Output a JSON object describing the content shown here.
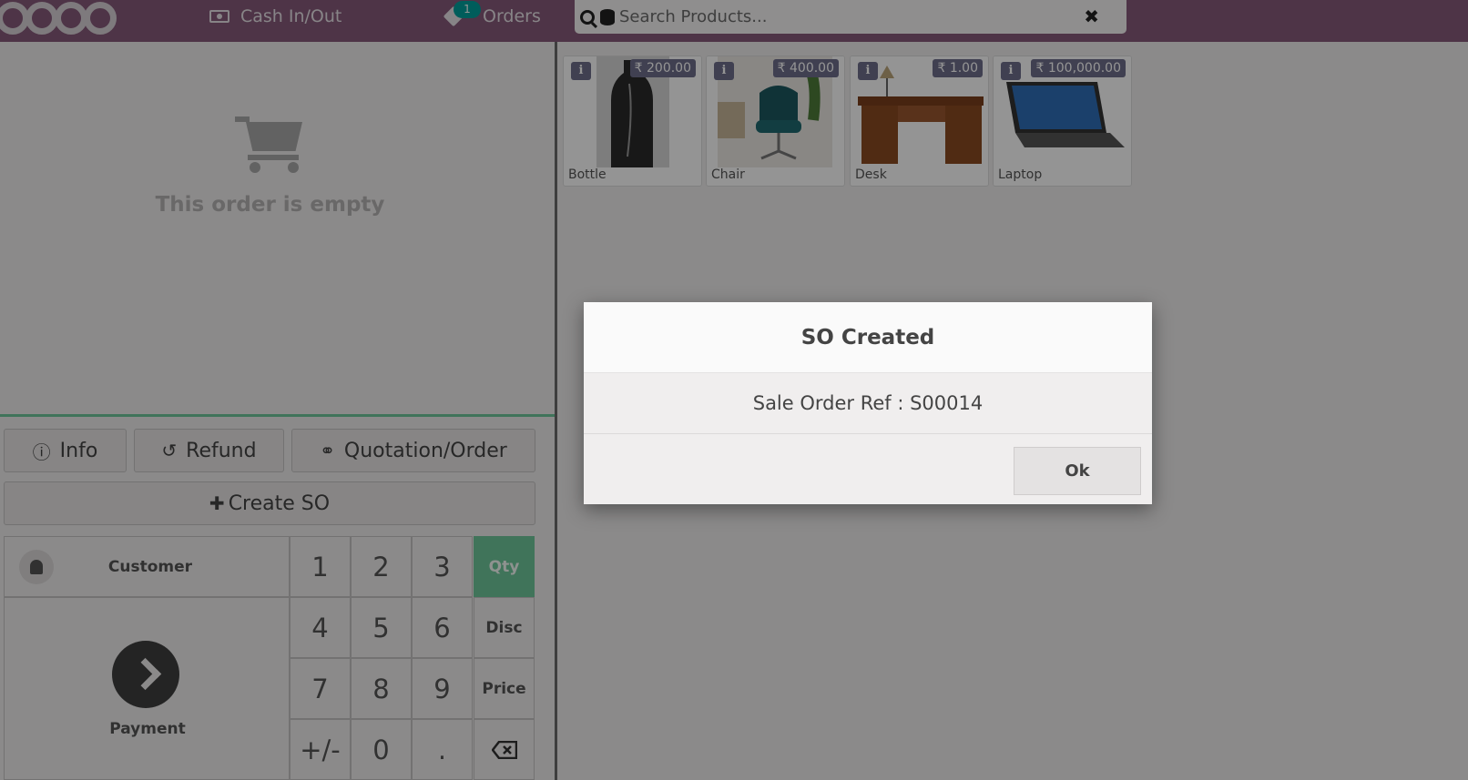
{
  "topbar": {
    "cash_label": "Cash In/Out",
    "orders_label": "Orders",
    "orders_badge": "1",
    "search_placeholder": "Search Products..."
  },
  "order": {
    "empty_text": "This order is empty"
  },
  "controls": {
    "info_label": "Info",
    "refund_label": "Refund",
    "quotation_label": "Quotation/Order",
    "create_so_label": "Create SO"
  },
  "numpad": {
    "customer_label": "Customer",
    "payment_label": "Payment",
    "keys": [
      "1",
      "2",
      "3",
      "Qty",
      "4",
      "5",
      "6",
      "Disc",
      "7",
      "8",
      "9",
      "Price",
      "+/-",
      "0",
      "."
    ],
    "active_mode": "Qty"
  },
  "products": [
    {
      "name": "Bottle",
      "price": "₹ 200.00"
    },
    {
      "name": "Chair",
      "price": "₹ 400.00"
    },
    {
      "name": "Desk",
      "price": "₹ 1.00"
    },
    {
      "name": "Laptop",
      "price": "₹ 100,000.00"
    }
  ],
  "modal": {
    "title": "SO Created",
    "message": "Sale Order Ref : S00014",
    "ok_label": "Ok"
  },
  "colors": {
    "brand": "#875a7b",
    "accent_green": "#6ec89b",
    "badge": "#00a09d"
  }
}
